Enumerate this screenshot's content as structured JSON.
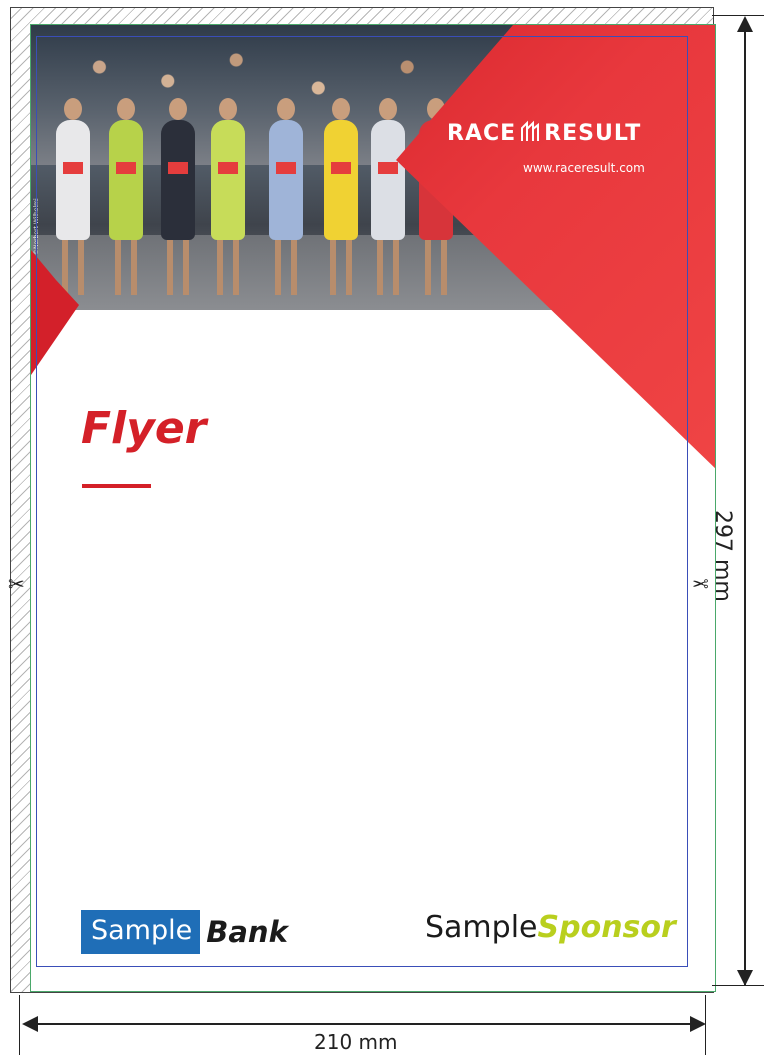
{
  "flyer": {
    "photo_credit": "©Norbert Wilhelmi",
    "brand_left": "RACE",
    "brand_right": "RESULT",
    "brand_url": "www.raceresult.com",
    "title": "Flyer",
    "sponsors": {
      "bank_prefix": "Sample",
      "bank_suffix": "Bank",
      "sponsor_prefix": "Sample",
      "sponsor_suffix": "Sponsor"
    }
  },
  "dimensions": {
    "width": "210 mm",
    "height": "297 mm"
  },
  "colors": {
    "brand_red": "#d42028",
    "bank_blue": "#1f6eb7",
    "sponsor_green": "#b9cf1e",
    "trim_line": "#4aa86a",
    "safe_line": "#3a4eb8"
  },
  "icons": [
    "scissors-icon",
    "race-result-logo-icon"
  ]
}
